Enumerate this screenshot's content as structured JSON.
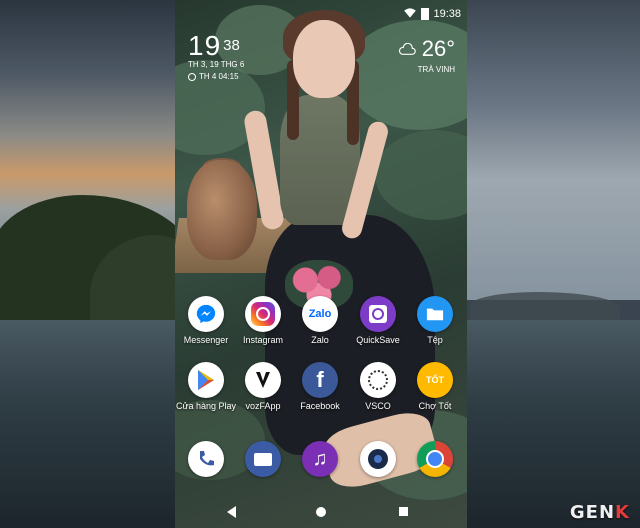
{
  "statusbar": {
    "time": "19:38"
  },
  "clock": {
    "hour": "19",
    "minute": "38",
    "date": "TH 3, 19 THG 6",
    "alarm": "TH 4 04:15"
  },
  "weather": {
    "temp": "26°",
    "location": "TRÀ VINH"
  },
  "apps": {
    "messenger": "Messenger",
    "instagram": "Instagram",
    "zalo": "Zalo",
    "zalo_logo": "Zalo",
    "quicksave": "QuickSave",
    "tep": "Tệp",
    "play": "Cửa hàng Play",
    "vozfapp": "vozFApp",
    "facebook": "Facebook",
    "vsco": "VSCO",
    "chotot": "Chợ Tốt",
    "chotot_logo": "TỐT"
  },
  "dock": [
    "phone-dialer-icon",
    "messages-icon",
    "music-icon",
    "camera-icon",
    "chrome-icon"
  ],
  "watermark": {
    "prefix": "GEN",
    "accent": "K"
  },
  "colors": {
    "messenger": "#ffffff",
    "instagram": "#c13584",
    "zalo": "#0068ff",
    "quicksave": "#7d3cc7",
    "tep": "#2196f3",
    "facebook": "#3b5998",
    "chotot": "#ffba00",
    "music": "#7b2fb5",
    "chrome_red": "#db4437"
  }
}
